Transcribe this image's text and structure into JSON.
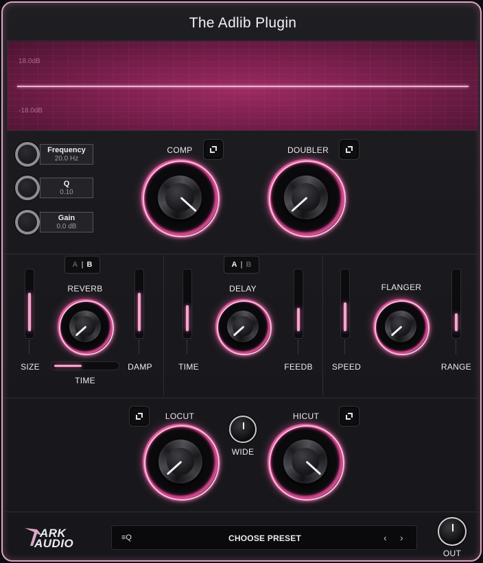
{
  "app": {
    "title": "The Adlib Plugin"
  },
  "analyzer": {
    "db_top": "18.0dB",
    "db_bottom": "-18.0dB"
  },
  "params": [
    {
      "name": "Frequency",
      "value": "20.0 Hz"
    },
    {
      "name": "Q",
      "value": "0.10"
    },
    {
      "name": "Gain",
      "value": "0.0 dB"
    }
  ],
  "top_section": {
    "comp_label": "COMP",
    "doubler_label": "DOUBLER"
  },
  "reverb": {
    "ab_a": "A",
    "ab_sep": "|",
    "ab_b": "B",
    "label": "REVERB",
    "size": "SIZE",
    "damp": "DAMP",
    "time": "TIME"
  },
  "delay": {
    "ab_a": "A",
    "ab_sep": "|",
    "ab_b": "B",
    "label": "DELAY",
    "time": "TIME",
    "feedb": "FEEDB"
  },
  "flanger": {
    "label": "FLANGER",
    "speed": "SPEED",
    "range": "RANGE"
  },
  "filter": {
    "locut": "LOCUT",
    "hicut": "HICUT",
    "wide": "WIDE"
  },
  "footer": {
    "logo_line1": "ARK",
    "logo_line2": "AUDIO",
    "preset": "CHOOSE PRESET",
    "prev": "‹",
    "next": "›",
    "out": "OUT",
    "preset_icon": "≡Q"
  },
  "colors": {
    "accent": "#e25aa0",
    "analyzer": "#7a1f4d",
    "frame": "#d9a8c4"
  }
}
